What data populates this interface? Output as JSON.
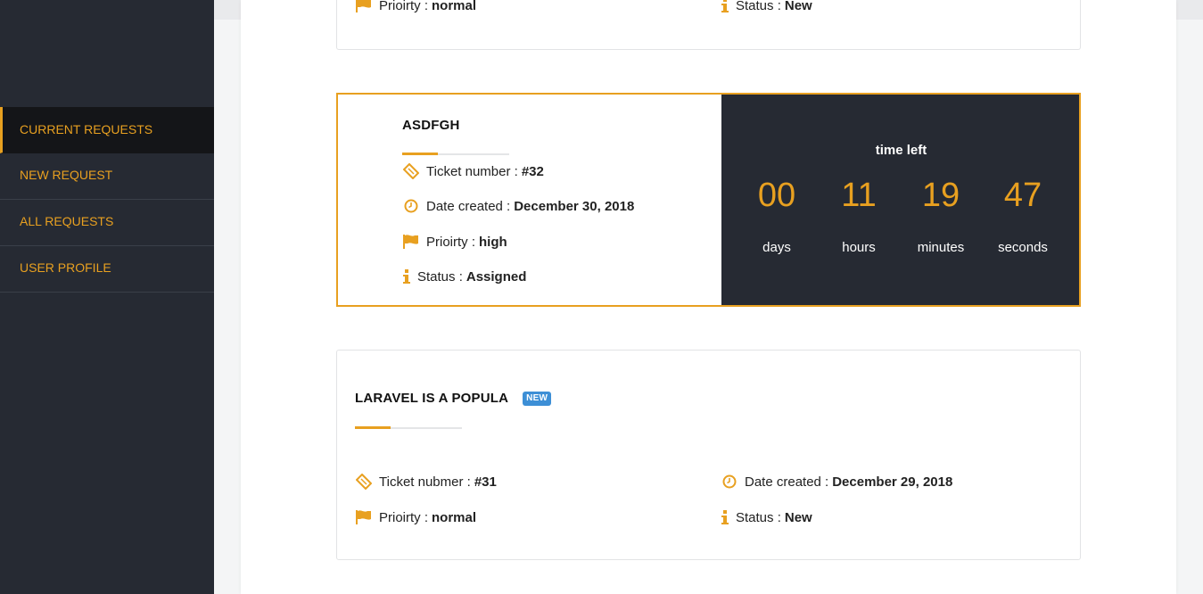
{
  "sidebar": {
    "items": [
      {
        "label": "CURRENT REQUESTS"
      },
      {
        "label": "NEW REQUEST"
      },
      {
        "label": "ALL REQUESTS"
      },
      {
        "label": "USER PROFILE"
      }
    ]
  },
  "cards": [
    {
      "priority_label": "Prioirty :",
      "priority": "normal",
      "status_label": "Status :",
      "status": "New"
    },
    {
      "title": "ASDFGH",
      "ticket_label": "Ticket number :",
      "ticket": "#32",
      "date_label": "Date created :",
      "date": "December 30, 2018",
      "priority_label": "Prioirty :",
      "priority": "high",
      "status_label": "Status :",
      "status": "Assigned",
      "timer": {
        "label": "time left",
        "days": "00",
        "days_label": "days",
        "hours": "11",
        "hours_label": "hours",
        "minutes": "19",
        "minutes_label": "minutes",
        "seconds": "47",
        "seconds_label": "seconds"
      }
    },
    {
      "title": "LARAVEL IS A POPULA",
      "badge": "NEW",
      "ticket_label": "Ticket nubmer :",
      "ticket": "#31",
      "date_label": "Date created :",
      "date": "December 29, 2018",
      "priority_label": "Prioirty :",
      "priority": "normal",
      "status_label": "Status :",
      "status": "New"
    }
  ],
  "colors": {
    "accent": "#e8a020",
    "sidebar": "#262a33",
    "badge": "#3d8fd6"
  },
  "icons": [
    "ticket-icon",
    "clock-icon",
    "flag-icon",
    "info-icon"
  ]
}
